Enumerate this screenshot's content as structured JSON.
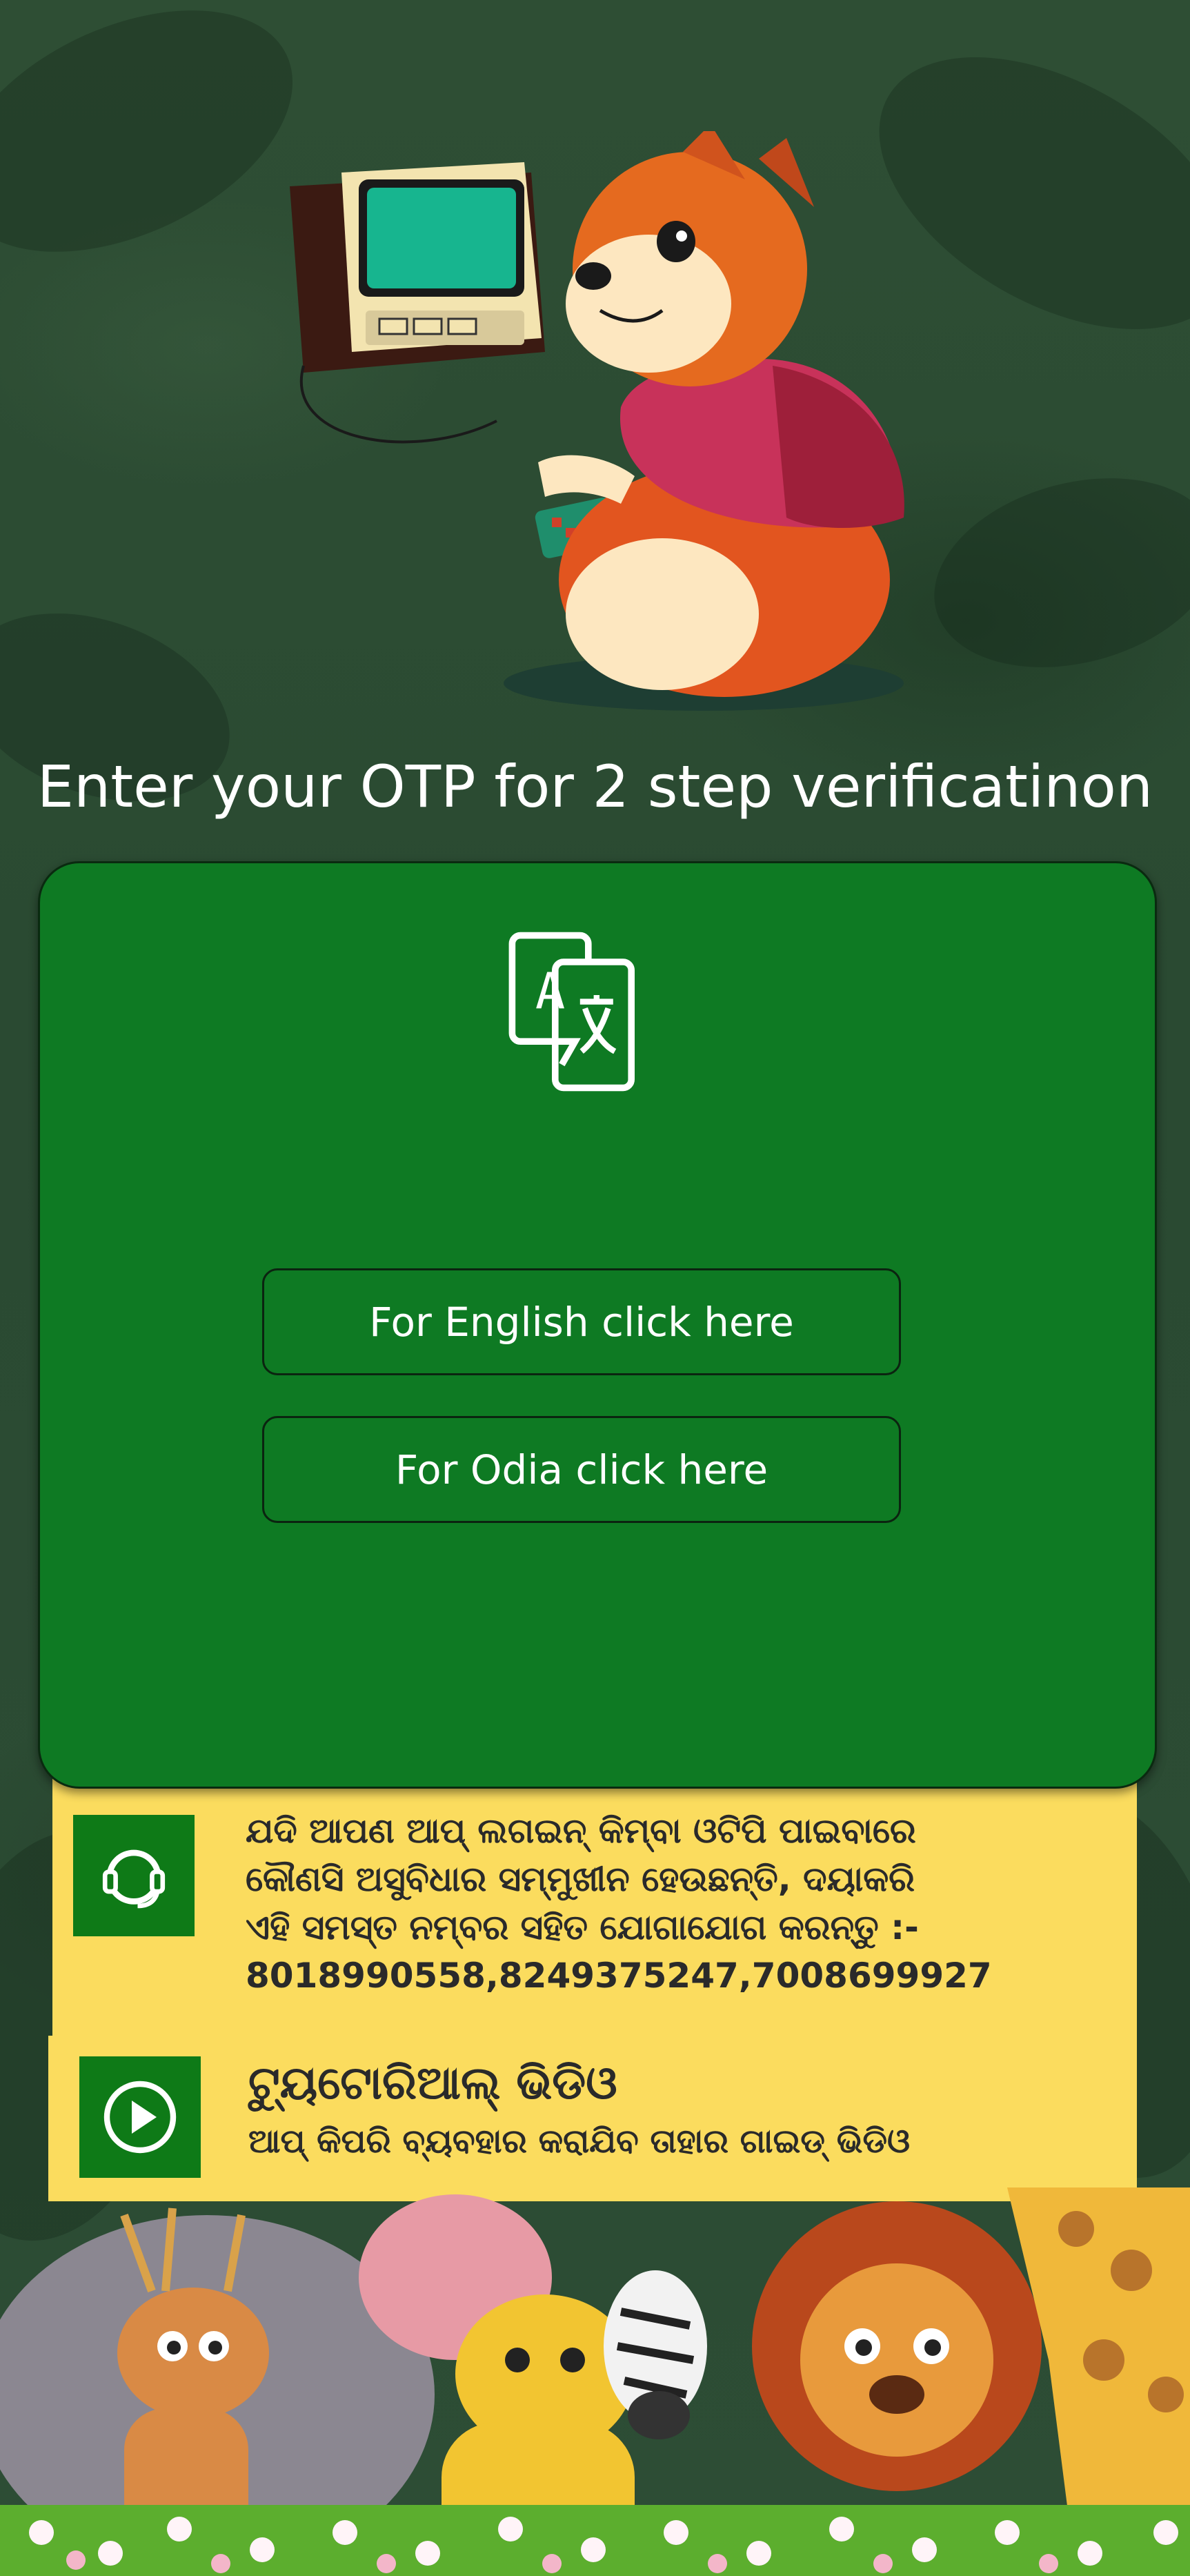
{
  "otp_title": "Enter your OTP for 2 step verificatinon",
  "modal": {
    "icon": "translate-icon",
    "english_button": "For English click here",
    "odia_button": "For Odia click here"
  },
  "help": {
    "icon": "headset-icon",
    "line1": "ଯଦି ଆପଣ ଆପ୍ ଲଗଇନ୍ କିମ୍ବା ଓଟିପି ପାଇବାରେ",
    "line2": "କୌଣସି ଅସୁବିଧାର ସମ୍ମୁଖୀନ ହେଉଛନ୍ତି, ଦୟାକରି",
    "line3": "ଏହି ସମସ୍ତ ନମ୍ବର ସହିତ ଯୋଗାଯୋଗ କରନ୍ତୁ :-",
    "phones": "8018990558,8249375247,7008699927"
  },
  "tutorial": {
    "icon": "play-icon",
    "title": "ଟ୍ୟୁଟୋରିଆଲ୍ ଭିଡିଓ",
    "subtitle": "ଆପ୍ କିପରି ବ୍ୟବହାର କରାଯିବ ତାହାର ଗାଇଡ୍ ଭିଡିଓ"
  },
  "colors": {
    "modal_green": "#0e7a23",
    "panel_yellow": "#fbdc5e",
    "icon_green": "#0e7a17",
    "background": "#2f4f36"
  }
}
